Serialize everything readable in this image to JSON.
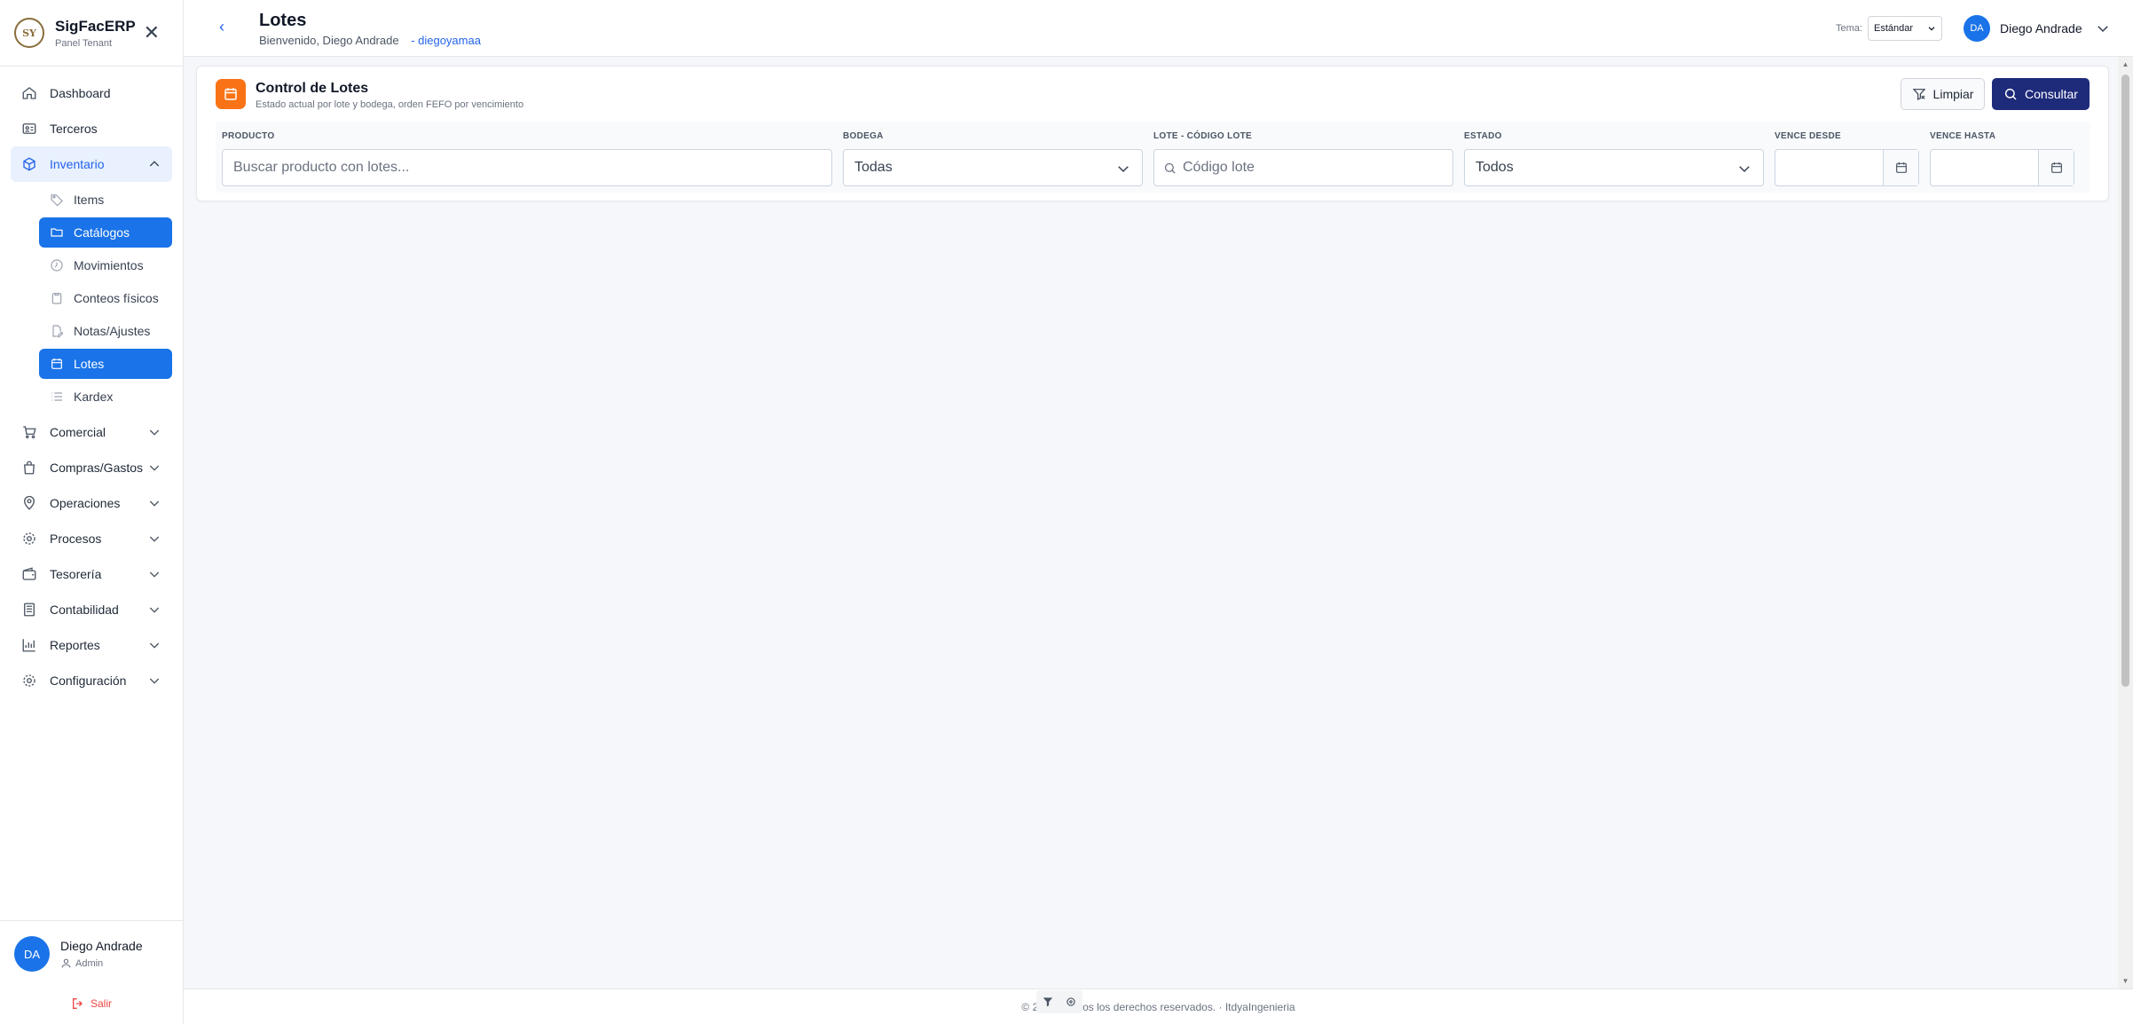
{
  "brand": {
    "title": "SigFacERP",
    "subtitle": "Panel Tenant",
    "logo_text": "SY"
  },
  "sidebar": {
    "items": [
      {
        "label": "Dashboard",
        "icon": "home-icon"
      },
      {
        "label": "Terceros",
        "icon": "id-card-icon"
      },
      {
        "label": "Inventario",
        "icon": "box-icon",
        "expanded": true,
        "children": [
          {
            "label": "Items",
            "icon": "tag-icon"
          },
          {
            "label": "Catálogos",
            "icon": "folder-icon",
            "active": true
          },
          {
            "label": "Movimientos",
            "icon": "clock-icon"
          },
          {
            "label": "Conteos físicos",
            "icon": "clipboard-icon"
          },
          {
            "label": "Notas/Ajustes",
            "icon": "edit-file-icon"
          },
          {
            "label": "Lotes",
            "icon": "calendar-icon",
            "active": true
          },
          {
            "label": "Kardex",
            "icon": "list-icon"
          }
        ]
      },
      {
        "label": "Comercial",
        "icon": "cart-icon"
      },
      {
        "label": "Compras/Gastos",
        "icon": "bag-icon"
      },
      {
        "label": "Operaciones",
        "icon": "map-pin-icon"
      },
      {
        "label": "Procesos",
        "icon": "gear-icon"
      },
      {
        "label": "Tesorería",
        "icon": "wallet-icon"
      },
      {
        "label": "Contabilidad",
        "icon": "ledger-icon"
      },
      {
        "label": "Reportes",
        "icon": "bar-chart-icon"
      },
      {
        "label": "Configuración",
        "icon": "settings-icon"
      }
    ]
  },
  "sidebar_footer": {
    "initials": "DA",
    "name": "Diego Andrade",
    "role": "Admin",
    "logout": "Salir"
  },
  "header": {
    "title": "Lotes",
    "welcome": "Bienvenido, Diego Andrade",
    "tenant": "- diegoyamaa",
    "theme_label": "Tema:",
    "theme_value": "Estándar",
    "user_initials": "DA",
    "user_name": "Diego Andrade"
  },
  "card": {
    "title": "Control de Lotes",
    "subtitle": "Estado actual por lote y bodega, orden FEFO por vencimiento",
    "clear_label": "Limpiar",
    "query_label": "Consultar"
  },
  "filters": {
    "producto": {
      "label": "PRODUCTO",
      "placeholder": "Buscar producto con lotes..."
    },
    "bodega": {
      "label": "BODEGA",
      "value": "Todas"
    },
    "lote": {
      "label": "LOTE - CÓDIGO LOTE",
      "placeholder": "Código lote"
    },
    "estado": {
      "label": "ESTADO",
      "value": "Todos"
    },
    "vence_desde": {
      "label": "VENCE DESDE",
      "value": ""
    },
    "vence_hasta": {
      "label": "VENCE HASTA",
      "value": ""
    }
  },
  "footer": {
    "text": "© 2026 · Todos los derechos reservados. · ItdyaIngenieria"
  },
  "colors": {
    "accent": "#1a73e8",
    "primary_button": "#1e2a7a",
    "card_icon": "#f97316",
    "logout": "#ef4444"
  }
}
